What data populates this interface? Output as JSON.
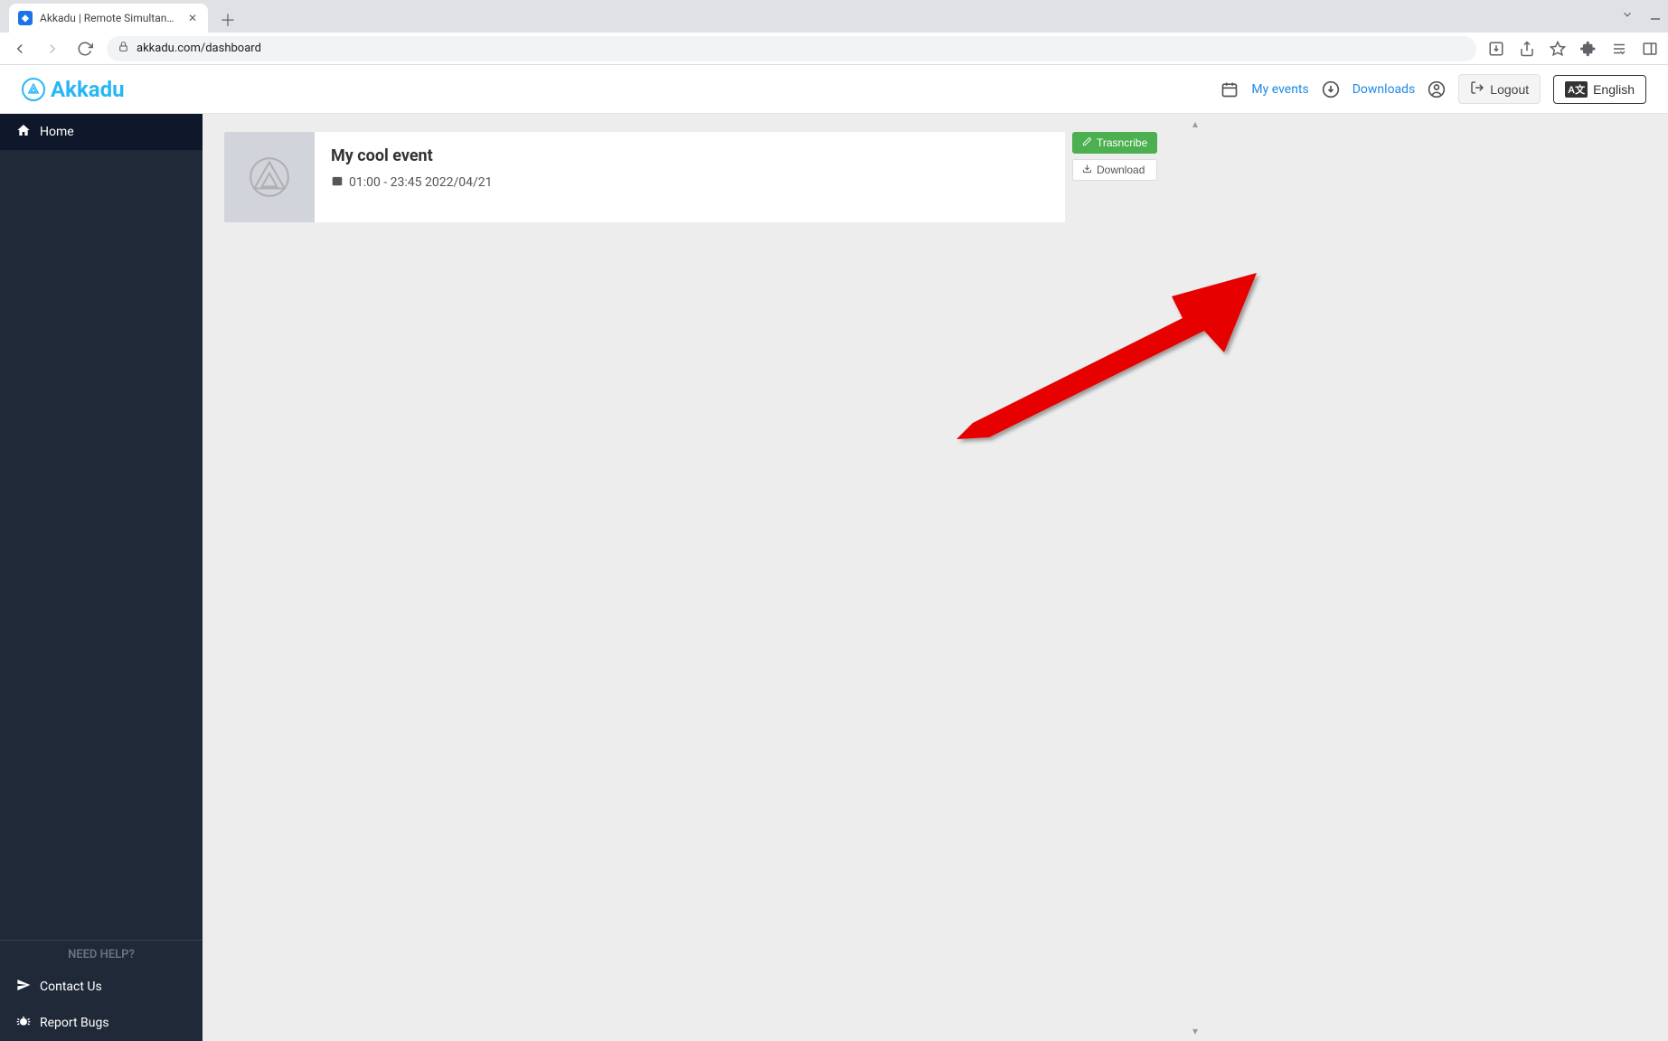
{
  "browser": {
    "tab_title": "Akkadu | Remote Simultaneou",
    "url": "akkadu.com/dashboard"
  },
  "header": {
    "brand": "Akkadu",
    "my_events": "My events",
    "downloads": "Downloads",
    "logout": "Logout",
    "language": "English"
  },
  "sidebar": {
    "home": "Home",
    "need_help": "NEED HELP?",
    "contact_us": "Contact Us",
    "report_bugs": "Report Bugs"
  },
  "event": {
    "title": "My cool event",
    "time": "01:00 - 23:45 2022/04/21",
    "transcribe_label": "Trasncribe",
    "download_label": "Download"
  }
}
